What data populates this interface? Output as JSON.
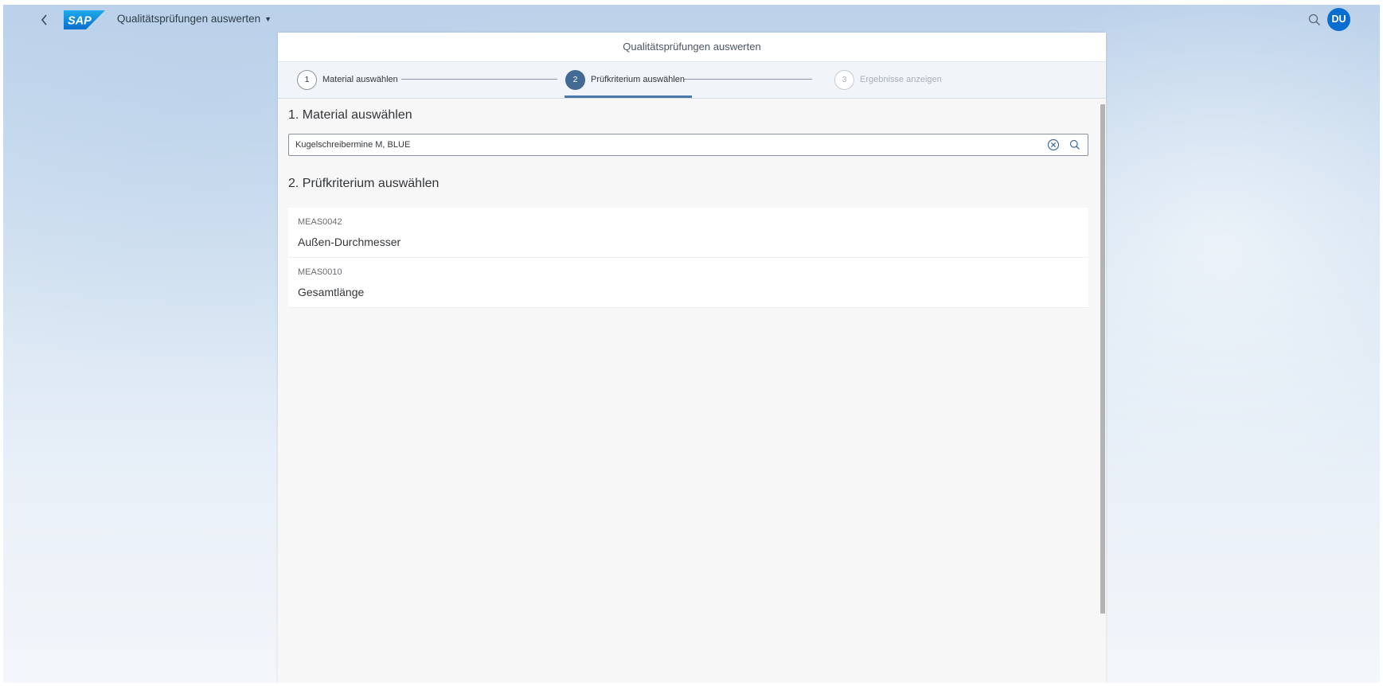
{
  "shell": {
    "logo_text": "SAP",
    "app_title": "Qualitätsprüfungen auswerten",
    "avatar_initials": "DU"
  },
  "panel": {
    "title": "Qualitätsprüfungen auswerten"
  },
  "wizard": {
    "steps": [
      {
        "number": "1",
        "label": "Material auswählen",
        "state": "completed"
      },
      {
        "number": "2",
        "label": "Prüfkriterium auswählen",
        "state": "active"
      },
      {
        "number": "3",
        "label": "Ergebnisse anzeigen",
        "state": "disabled"
      }
    ]
  },
  "step1": {
    "title": "1. Material auswählen",
    "search_value": "Kugelschreibermine M, BLUE"
  },
  "step2": {
    "title": "2. Prüfkriterium auswählen",
    "items": [
      {
        "id": "MEAS0042",
        "name": "Außen-Durchmesser"
      },
      {
        "id": "MEAS0010",
        "name": "Gesamtlänge"
      }
    ]
  },
  "colors": {
    "accent": "#0a6ed1",
    "active_step": "#426a95"
  }
}
